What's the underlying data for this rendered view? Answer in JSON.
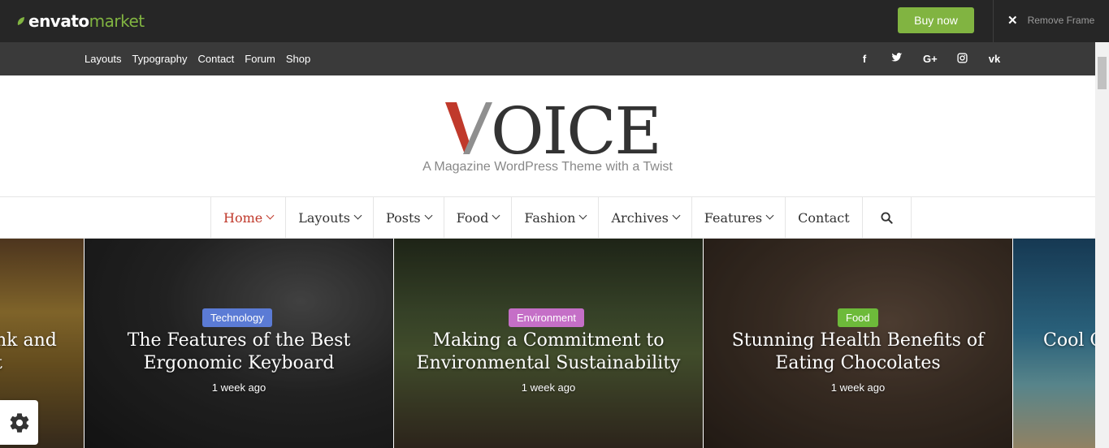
{
  "envato": {
    "logo_word1": "envato",
    "logo_word2": "market",
    "buy_now": "Buy now",
    "remove_frame": "Remove Frame",
    "accent": "#81b441"
  },
  "top_links": [
    "Layouts",
    "Typography",
    "Contact",
    "Forum",
    "Shop"
  ],
  "social": [
    {
      "icon": "facebook-icon",
      "glyph": "f"
    },
    {
      "icon": "twitter-icon",
      "glyph": "t"
    },
    {
      "icon": "google-plus-icon",
      "glyph": "G+"
    },
    {
      "icon": "instagram-icon",
      "glyph": "◎"
    },
    {
      "icon": "vk-icon",
      "glyph": "vk"
    }
  ],
  "header": {
    "logo": "VOICE",
    "tagline": "A Magazine WordPress Theme with a Twist",
    "logo_colors": {
      "v_red": "#c0392b",
      "v_gray": "#8f8f8f",
      "text": "#333333"
    }
  },
  "nav": {
    "items": [
      {
        "label": "Home",
        "dropdown": true,
        "active": true
      },
      {
        "label": "Layouts",
        "dropdown": true
      },
      {
        "label": "Posts",
        "dropdown": true
      },
      {
        "label": "Food",
        "dropdown": true
      },
      {
        "label": "Fashion",
        "dropdown": true
      },
      {
        "label": "Archives",
        "dropdown": true
      },
      {
        "label": "Features",
        "dropdown": true
      },
      {
        "label": "Contact",
        "dropdown": false
      }
    ],
    "active_color": "#c0392b"
  },
  "slides": [
    {
      "partial": "left",
      "title_line1": "nk and",
      "title_line2": "t",
      "bg": "#8a6a2a"
    },
    {
      "category": "Technology",
      "category_color": "#5b7bd5",
      "title_line1": "The Features of the Best",
      "title_line2": "Ergonomic Keyboard",
      "meta": "1 week ago",
      "bg": "#2b2b2b"
    },
    {
      "category": "Environment",
      "category_color": "#c56fc7",
      "title_line1": "Making a Commitment to",
      "title_line2": "Environmental Sustainability",
      "meta": "1 week ago",
      "bg": "#3d4a2d"
    },
    {
      "category": "Food",
      "category_color": "#6dba3a",
      "title_line1": "Stunning Health Benefits of",
      "title_line2": "Eating Chocolates",
      "meta": "1 week ago",
      "bg": "#4a3a2e"
    },
    {
      "partial": "right",
      "title_line1": "Cool C",
      "bg": "#2a6a8a"
    }
  ]
}
